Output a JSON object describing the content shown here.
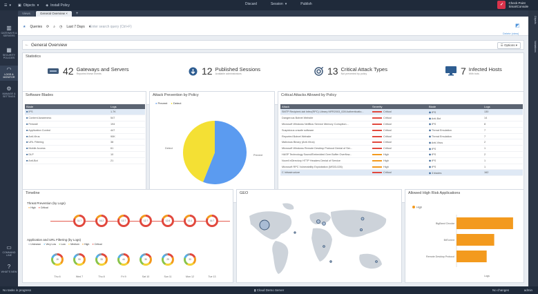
{
  "topbar": {
    "menu_label": "",
    "objects_label": "Objects",
    "install_label": "Install Policy",
    "center_a": "Discard",
    "center_b": "Session",
    "center_c": "Publish",
    "brand_line1": "Check Point",
    "brand_line2": "SmartConsole"
  },
  "tabs": [
    {
      "label": "Views"
    },
    {
      "label": "General Overview"
    }
  ],
  "nav": [
    {
      "label": "GATEWAYS & SERVERS",
      "icon": "gateways-icon"
    },
    {
      "label": "SECURITY POLICIES",
      "icon": "policies-icon"
    },
    {
      "label": "LOGS & MONITOR",
      "icon": "logs-monitor-icon"
    },
    {
      "label": "MANAGE & SETTINGS",
      "icon": "settings-icon"
    },
    {
      "label": "COMMAND LINE",
      "icon": "command-line-icon"
    },
    {
      "label": "WHAT'S NEW",
      "icon": "whats-new-icon"
    }
  ],
  "right_strip": [
    "Objects",
    "Validations"
  ],
  "toolbar": {
    "queries_label": "Queries",
    "time_filter": "Last 7 Days",
    "search_placeholder": "Enter search query (Ctrl+F)",
    "delete_label": "Delete (view)"
  },
  "page": {
    "title": "General Overview",
    "options_label": "Options"
  },
  "statistics": {
    "title": "Statistics",
    "items": [
      {
        "value": "42",
        "label": "Gateways and Servers",
        "sub": "Reported these events",
        "icon": "gateway-server-icon"
      },
      {
        "value": "12",
        "label": "Published Sessions",
        "sub": "Available administrators",
        "icon": "download-session-icon"
      },
      {
        "value": "13",
        "label": "Critical Attack Types",
        "sub": "Not prevented by policy",
        "icon": "attack-target-icon"
      },
      {
        "value": "7",
        "label": "Infected Hosts",
        "sub": "With bots",
        "icon": "monitor-icon"
      }
    ]
  },
  "software_blades": {
    "title": "Software Blades",
    "columns": [
      "Blade",
      "Logs"
    ],
    "rows": [
      {
        "blade": "IPS",
        "logs": "1.7K"
      },
      {
        "blade": "Content Awareness",
        "logs": "547"
      },
      {
        "blade": "Firewall",
        "logs": "194"
      },
      {
        "blade": "Application Control",
        "logs": "447"
      },
      {
        "blade": "Anti-Virus",
        "logs": "90K"
      },
      {
        "blade": "URL Filtering",
        "logs": "38"
      },
      {
        "blade": "Mobile Access",
        "logs": "61"
      },
      {
        "blade": "DLP",
        "logs": "10"
      },
      {
        "blade": "Anti-Bot",
        "logs": "21"
      }
    ]
  },
  "attack_prevention": {
    "title": "Attack Prevention by Policy",
    "legend": [
      "Prevent",
      "Detect"
    ],
    "label_left": "Detect",
    "label_right": "Prevent"
  },
  "chart_data": [
    {
      "type": "pie",
      "title": "Attack Prevention by Policy",
      "categories": [
        "Prevent",
        "Detect"
      ],
      "values": [
        56,
        44
      ],
      "colors": [
        "#5b9bf0",
        "#f4e034"
      ]
    },
    {
      "type": "bar",
      "title": "Allowed High Risk Applications",
      "categories": [
        "BigBand Circular",
        "BitTorrent",
        "Remote Desktop Protocol"
      ],
      "values": [
        4.5,
        3,
        2.4
      ],
      "legend": [
        "High"
      ],
      "color": "#f39a1e",
      "xlabel": "Logs",
      "xlim": [
        0,
        5
      ]
    }
  ],
  "critical_attacks": {
    "title": "Critical Attacks Allowed by Policy",
    "columns": [
      "Attack",
      "Severity",
      "Blade",
      "Logs"
    ],
    "rows": [
      {
        "attack": "SMTP Recipient-tab Infec(RPC) Library MFR2003_028 Authenticatio...",
        "severity": "Critical",
        "blade": "IPS",
        "logs": "130"
      },
      {
        "attack": "Dangerous Botnet Website",
        "severity": "Critical",
        "blade": "Anti-Bot",
        "logs": "14"
      },
      {
        "attack": "Microsoft Windows NetBios Service Memory Corruption...",
        "severity": "Critical",
        "blade": "IPS",
        "logs": "8"
      },
      {
        "attack": "Suspicious unsafe software",
        "severity": "Critical",
        "blade": "Threat Emulation",
        "logs": "7"
      },
      {
        "attack": "Reported Botnet Website",
        "severity": "Critical",
        "blade": "Threat Emulation",
        "logs": "7"
      },
      {
        "attack": "Malicious Binary (Anti-Virus)",
        "severity": "Critical",
        "blade": "Anti-Virus",
        "logs": "2"
      },
      {
        "attack": "Microsoft Windows Remote Desktop Protocol Denial of Ser...",
        "severity": "Critical",
        "blade": "IPS",
        "logs": "1"
      },
      {
        "attack": "HASP Technology Sound/Embedded Over Buffer Overflow...",
        "severity": "High",
        "blade": "IPS",
        "logs": "2"
      },
      {
        "attack": "Novell eDirectory HTTP Headers Denial of Service",
        "severity": "High",
        "blade": "IPS",
        "logs": "1"
      },
      {
        "attack": "Microsoft RPC Vulnerability Exploitation (MS03-026)",
        "severity": "High",
        "blade": "IPS",
        "logs": "1"
      },
      {
        "attack": "C Infrastructure",
        "severity": "Critical",
        "blade": "3 blades",
        "logs": "162"
      }
    ]
  },
  "timeline": {
    "title": "Timeline",
    "threat_title": "Threat Prevention (by Logs)",
    "threat_legend": [
      "High",
      "Critical"
    ],
    "threat_values": [
      "11.7",
      "16.2",
      "13.7",
      "12.7",
      "12.6",
      "13.1",
      "16.7"
    ],
    "app_title": "Application and URL Filtering (by Logs)",
    "app_legend": [
      "Unknown",
      "Very Low",
      "Low",
      "Medium",
      "High",
      "Critical"
    ],
    "app_values": [
      "19",
      "90",
      "33",
      "44",
      "30",
      "29",
      "33"
    ],
    "dates": [
      "Thu 6",
      "Wed 7",
      "Thu 8",
      "Fri 9",
      "Sat 10",
      "Sun 11",
      "Mon 12",
      "Tue 13"
    ]
  },
  "geo": {
    "title": "GEO"
  },
  "high_risk": {
    "title": "Allowed High Risk Applications"
  },
  "status": {
    "left": "No tasks in progress",
    "center": "Cloud Demo Server",
    "right_a": "No changes",
    "right_b": "admin"
  }
}
